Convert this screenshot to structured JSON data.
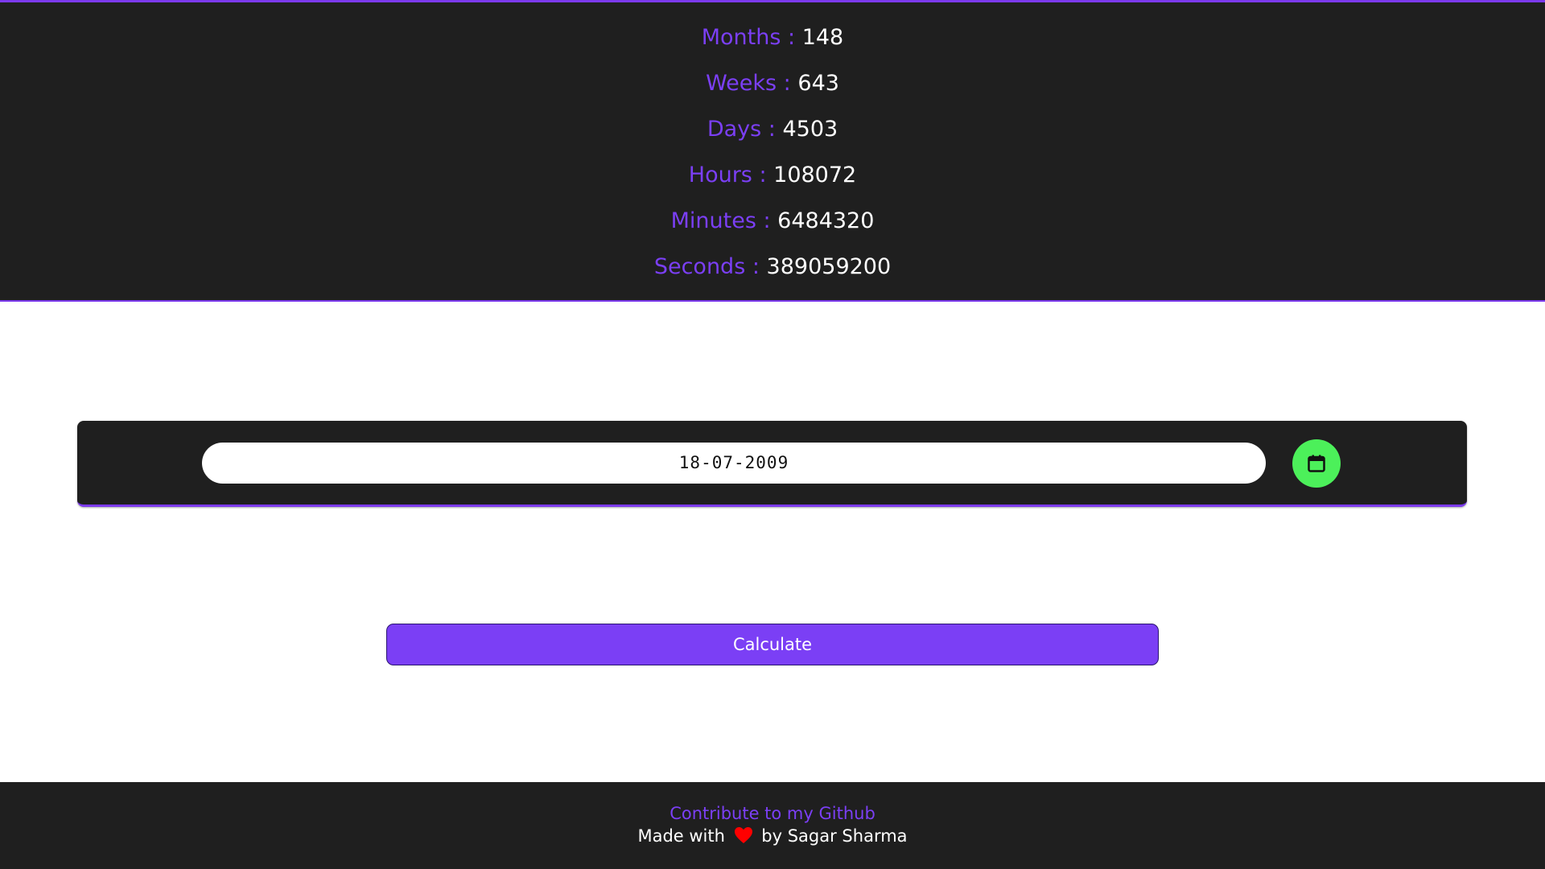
{
  "results": {
    "months": {
      "label": "Months :",
      "value": "148"
    },
    "weeks": {
      "label": "Weeks :",
      "value": "643"
    },
    "days": {
      "label": "Days :",
      "value": "4503"
    },
    "hours": {
      "label": "Hours :",
      "value": "108072"
    },
    "minutes": {
      "label": "Minutes :",
      "value": "6484320"
    },
    "seconds": {
      "label": "Seconds :",
      "value": "389059200"
    }
  },
  "form": {
    "date_value": "18-07-2009",
    "calendar_icon": "calendar-icon",
    "calculate_label": "Calculate"
  },
  "footer": {
    "github_link": "Contribute to my Github",
    "made_with": "Made with",
    "heart_icon": "heart-icon",
    "by_author": "by Sagar Sharma"
  },
  "colors": {
    "accent": "#7b3ff5",
    "panel_bg": "#1f1f1f",
    "calendar_button": "#4cf05a",
    "heart": "#ff0000"
  }
}
